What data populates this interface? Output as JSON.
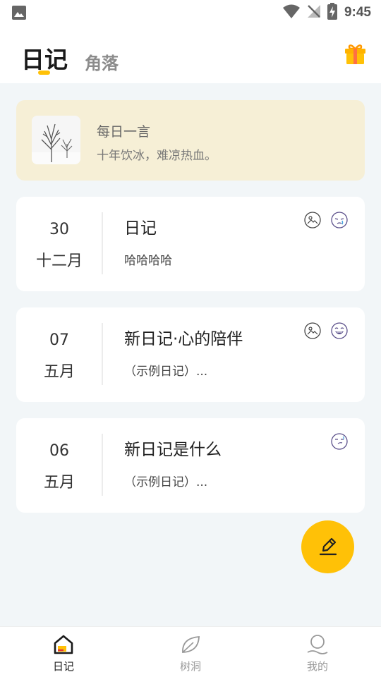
{
  "status_bar": {
    "time": "9:45"
  },
  "header": {
    "tabs": [
      {
        "label": "日记",
        "active": true
      },
      {
        "label": "角落",
        "active": false
      }
    ],
    "gift_icon": "gift-icon",
    "accent_color": "#ffc107"
  },
  "quote": {
    "title": "每日一言",
    "text": "十年饮冰，难凉热血。"
  },
  "entries": [
    {
      "day": "30",
      "month": "十二月",
      "title": "日记",
      "excerpt": "哈哈哈哈",
      "icons": [
        "image-icon",
        "crying-face-icon"
      ]
    },
    {
      "day": "07",
      "month": "五月",
      "title": "新日记·心的陪伴",
      "excerpt": "（示例日记）...",
      "icons": [
        "image-icon",
        "laughing-face-icon"
      ]
    },
    {
      "day": "06",
      "month": "五月",
      "title": "新日记是什么",
      "excerpt": "（示例日记）...",
      "icons": [
        "awkward-face-icon"
      ]
    }
  ],
  "bottom_nav": [
    {
      "label": "日记",
      "icon": "home-icon",
      "active": true
    },
    {
      "label": "树洞",
      "icon": "leaf-icon",
      "active": false
    },
    {
      "label": "我的",
      "icon": "profile-icon",
      "active": false
    }
  ]
}
